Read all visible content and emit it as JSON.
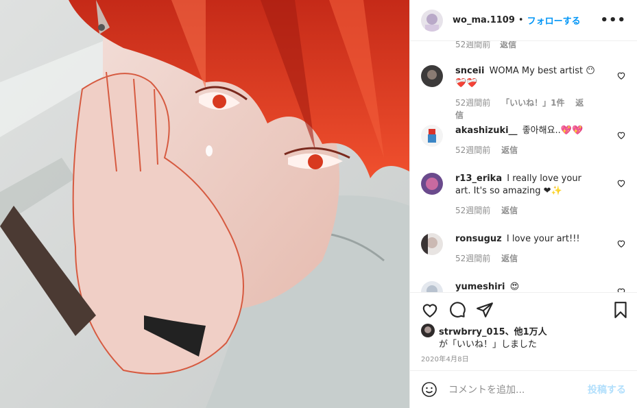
{
  "post": {
    "username": "wo_ma.1109",
    "separator": "•",
    "follow_label": "フォローする",
    "more_label": "•••"
  },
  "partial_comment": {
    "time": "52週間前",
    "reply": "返信"
  },
  "comments": [
    {
      "username": "snceii",
      "text": "WOMA My best artist 😶 ❤️‍🩹❤️‍🩹",
      "time": "52週間前",
      "likes": "「いいね！」1件",
      "reply": "返信"
    },
    {
      "username": "akashizuki__",
      "text": "좋아해요..💖💖",
      "time": "52週間前",
      "reply": "返信"
    },
    {
      "username": "r13_erika",
      "text": "I really love your art. It's so amazing ❤✨",
      "time": "52週間前",
      "reply": "返信"
    },
    {
      "username": "ronsuguz",
      "text": "I love your art!!!",
      "time": "52週間前",
      "reply": "返信"
    },
    {
      "username": "yumeshiri",
      "text": "😍",
      "time": "",
      "reply": ""
    }
  ],
  "likes": {
    "first_user": "strwbrry_015",
    "others": "、他1万人",
    "suffix": "が「いいね！」しました"
  },
  "date": "2020年4月8日",
  "add_comment": {
    "placeholder": "コメントを追加...",
    "post_label": "投稿する"
  },
  "colors": {
    "accent": "#0095f6",
    "post_disabled": "#b2dffc",
    "meta_gray": "#8e8e8e",
    "hair_red": "#e0432a"
  },
  "icons": [
    "heart-icon",
    "comment-icon",
    "share-icon",
    "bookmark-icon",
    "emoji-icon",
    "more-icon"
  ]
}
